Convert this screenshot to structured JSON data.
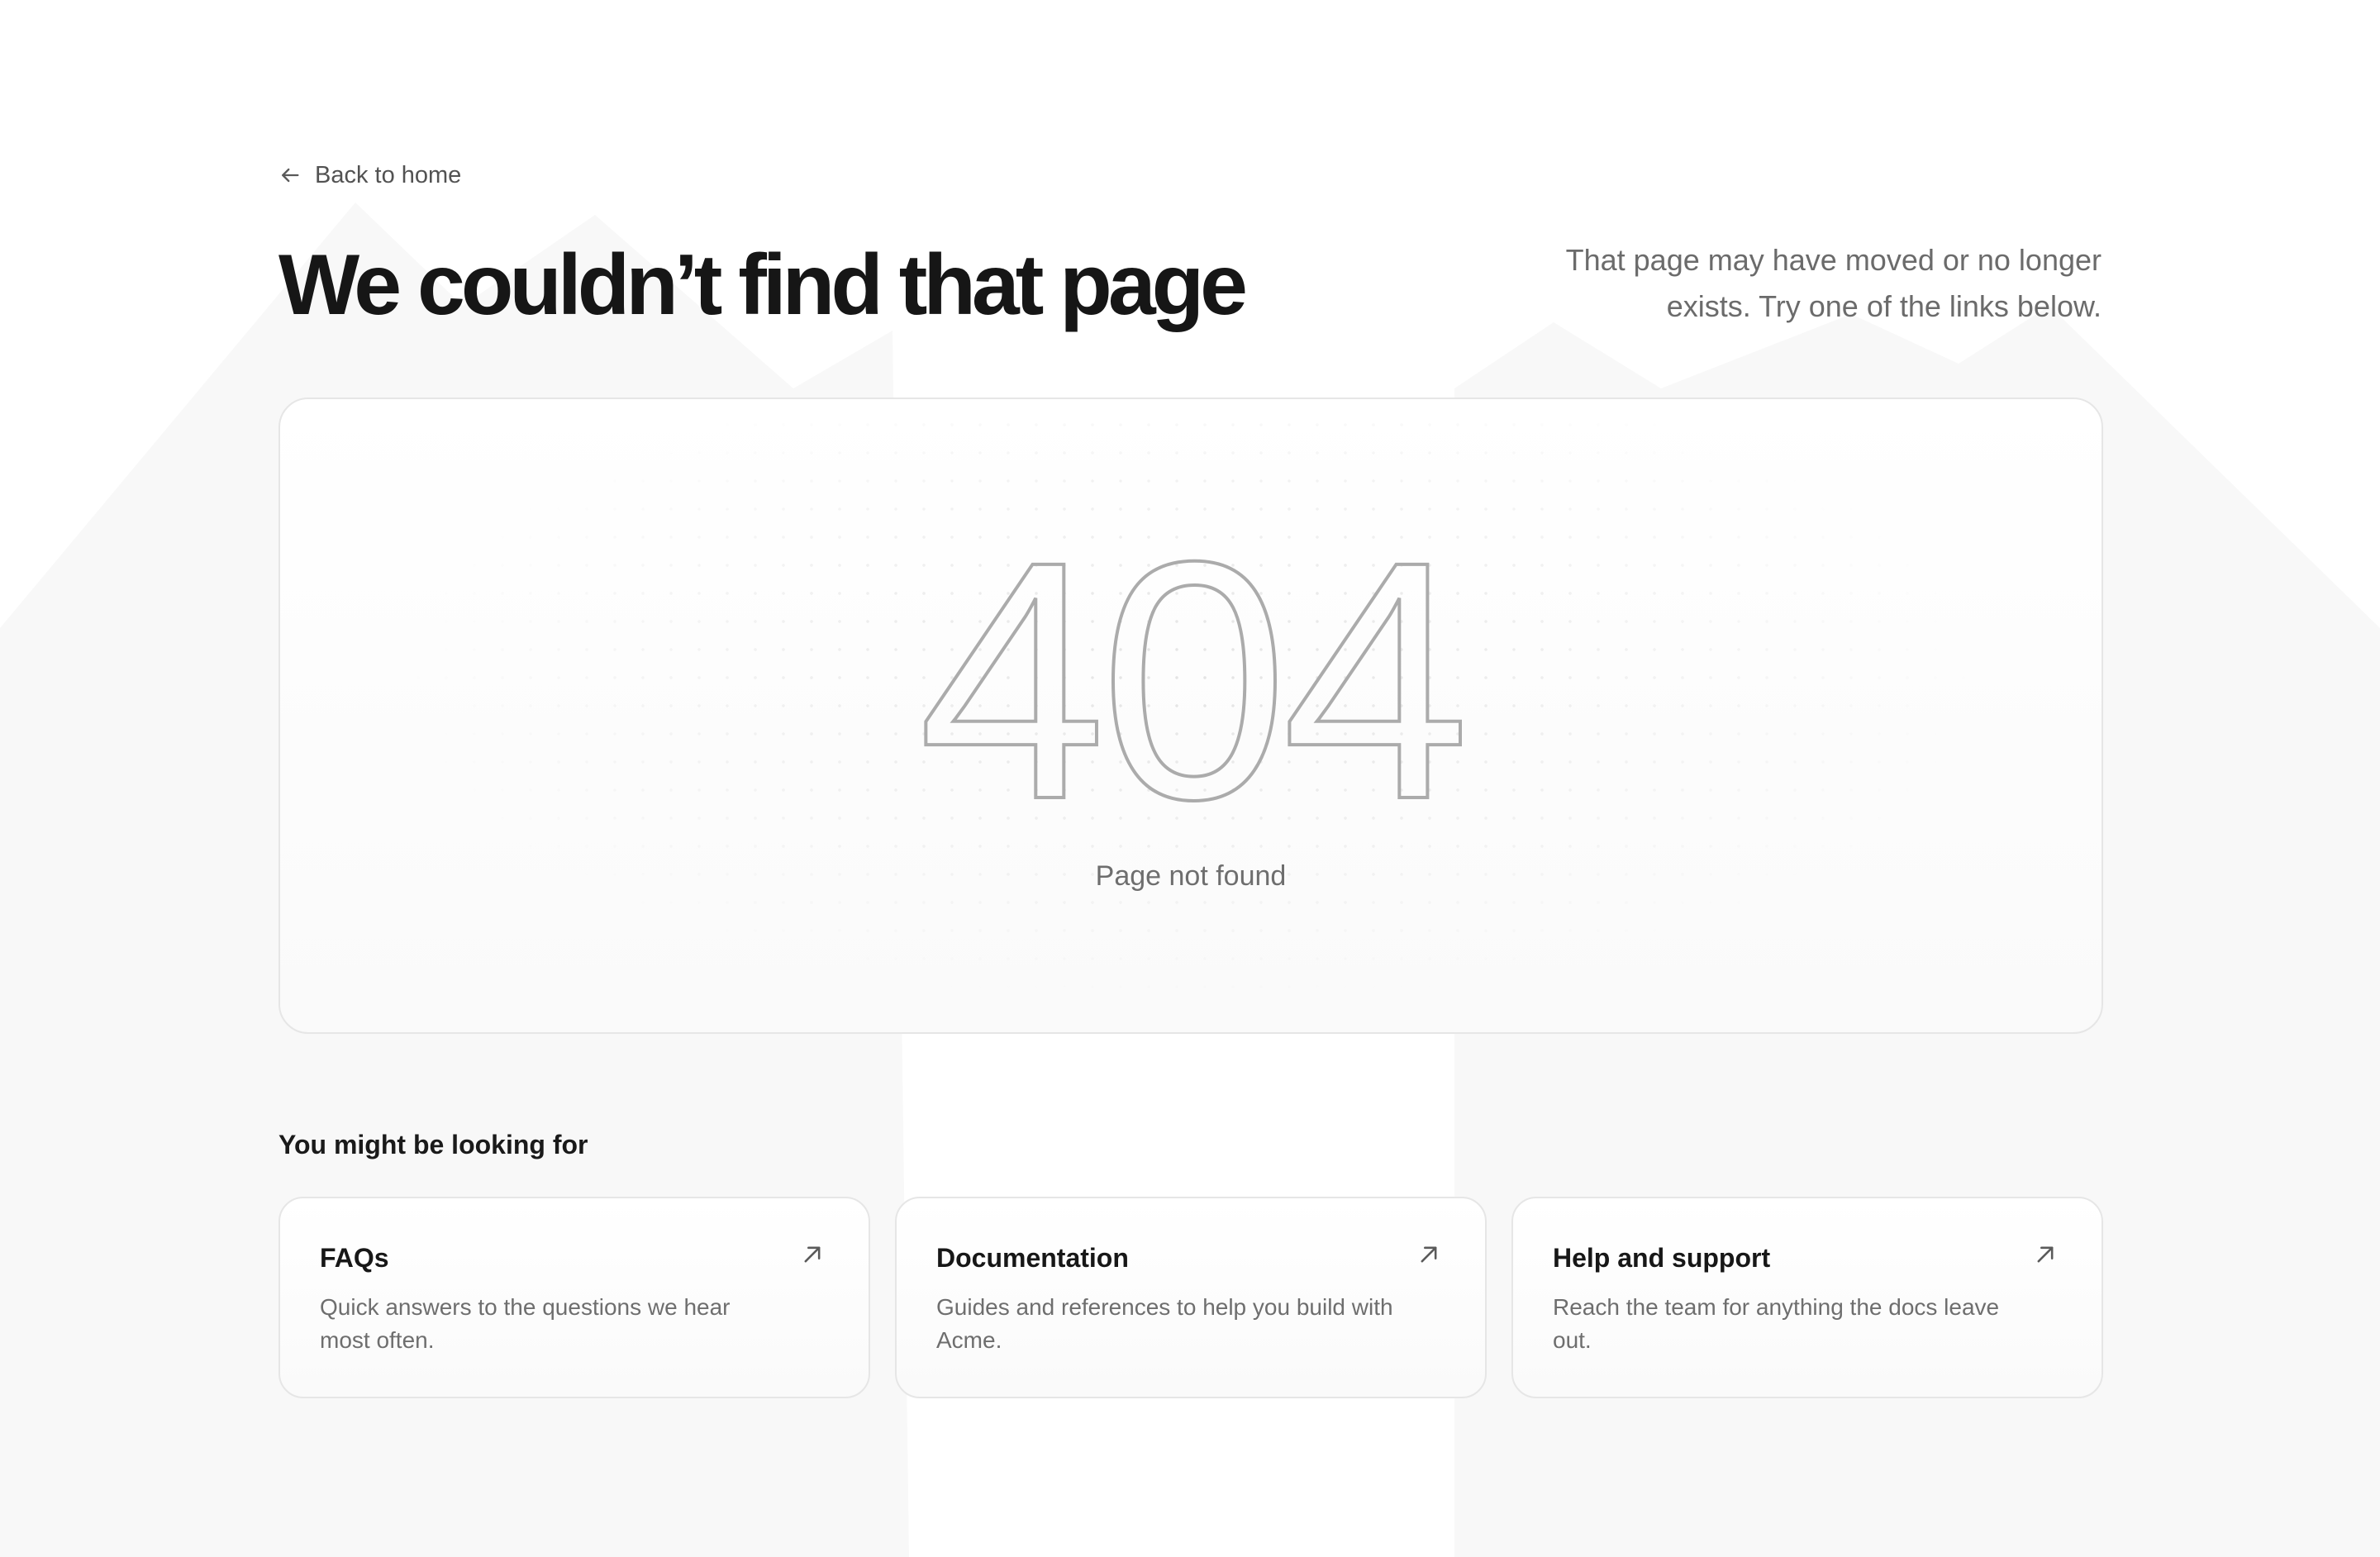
{
  "nav": {
    "back_label": "Back to home",
    "back_icon": "arrow-left-icon"
  },
  "header": {
    "title": "We couldn’t find that page",
    "subtitle": "That page may have moved or no longer exists. Try one of the links below."
  },
  "hero": {
    "code": "404",
    "caption": "Page not found"
  },
  "suggestions": {
    "heading": "You might be looking for",
    "items": [
      {
        "title": "FAQs",
        "description": "Quick answers to the questions we hear most often.",
        "icon": "arrow-up-right-icon"
      },
      {
        "title": "Documentation",
        "description": "Guides and references to help you build with Acme.",
        "icon": "arrow-up-right-icon"
      },
      {
        "title": "Help and support",
        "description": "Reach the team for anything the docs leave out.",
        "icon": "arrow-up-right-icon"
      }
    ]
  },
  "colors": {
    "title_text": "#161616",
    "muted_text": "#6b6b6b",
    "border": "#e6e6e6",
    "outline_digits": "#ababab",
    "background_shape": "#f7f7f7"
  }
}
